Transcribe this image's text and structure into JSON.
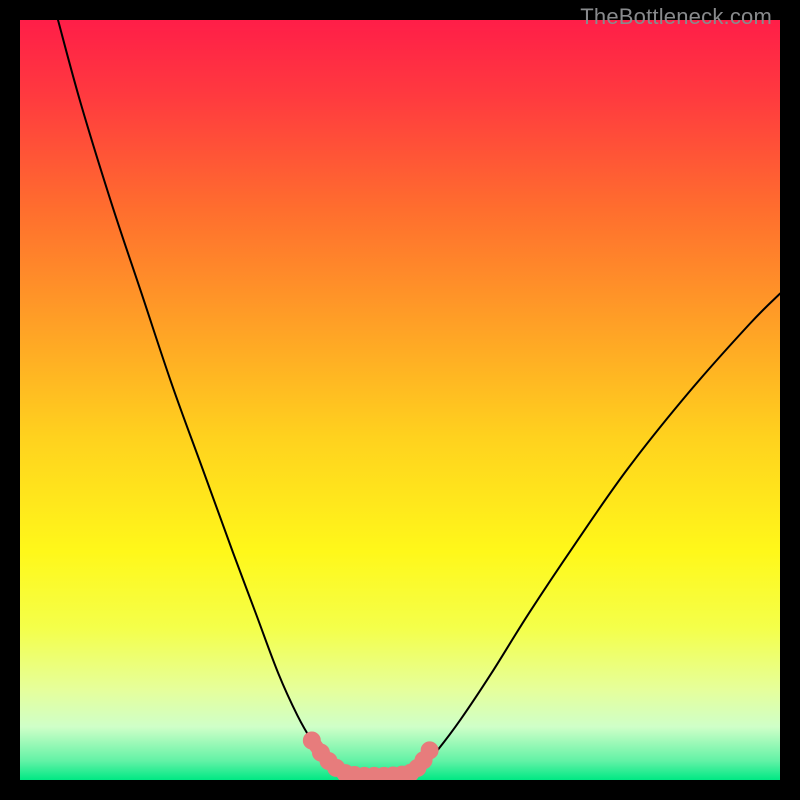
{
  "attribution": "TheBottleneck.com",
  "colors": {
    "black": "#000000",
    "curve": "#000000",
    "marker_fill": "#E77C7C",
    "marker_stroke": "#E77C7C"
  },
  "chart_data": {
    "type": "line",
    "title": "",
    "xlabel": "",
    "ylabel": "",
    "xlim": [
      0,
      100
    ],
    "ylim": [
      0,
      100
    ],
    "gradient_stops": [
      {
        "offset": 0.0,
        "color": "#FF1E48"
      },
      {
        "offset": 0.1,
        "color": "#FF3A3F"
      },
      {
        "offset": 0.25,
        "color": "#FF6E2E"
      },
      {
        "offset": 0.4,
        "color": "#FFA026"
      },
      {
        "offset": 0.55,
        "color": "#FFD21E"
      },
      {
        "offset": 0.7,
        "color": "#FFF81A"
      },
      {
        "offset": 0.8,
        "color": "#F4FF4A"
      },
      {
        "offset": 0.88,
        "color": "#E6FF9A"
      },
      {
        "offset": 0.93,
        "color": "#CFFFC8"
      },
      {
        "offset": 0.975,
        "color": "#62F2A6"
      },
      {
        "offset": 1.0,
        "color": "#00E884"
      }
    ],
    "series": [
      {
        "name": "left-curve",
        "x": [
          5,
          8,
          12,
          16,
          20,
          24,
          28,
          31,
          34,
          36.5,
          38.5,
          40,
          41.5,
          42.8
        ],
        "y": [
          100,
          89,
          76,
          64,
          52,
          41,
          30,
          22,
          14,
          8.5,
          5,
          3,
          1.5,
          0.8
        ]
      },
      {
        "name": "right-curve",
        "x": [
          51.5,
          53,
          55,
          58,
          62,
          67,
          73,
          80,
          88,
          96,
          100
        ],
        "y": [
          0.8,
          1.8,
          4,
          8,
          14,
          22,
          31,
          41,
          51,
          60,
          64
        ]
      },
      {
        "name": "bottom-flat",
        "x": [
          42.8,
          44,
          46,
          48,
          50,
          51.5
        ],
        "y": [
          0.8,
          0.6,
          0.55,
          0.55,
          0.6,
          0.8
        ]
      }
    ],
    "markers": {
      "name": "valley-markers",
      "x": [
        38.4,
        39.6,
        40.6,
        41.6,
        42.8,
        44.0,
        45.3,
        46.6,
        47.9,
        49.1,
        50.3,
        51.4,
        52.3,
        53.1,
        53.9
      ],
      "y": [
        5.2,
        3.6,
        2.5,
        1.6,
        0.9,
        0.65,
        0.55,
        0.55,
        0.55,
        0.6,
        0.7,
        0.95,
        1.6,
        2.6,
        3.9
      ]
    }
  }
}
